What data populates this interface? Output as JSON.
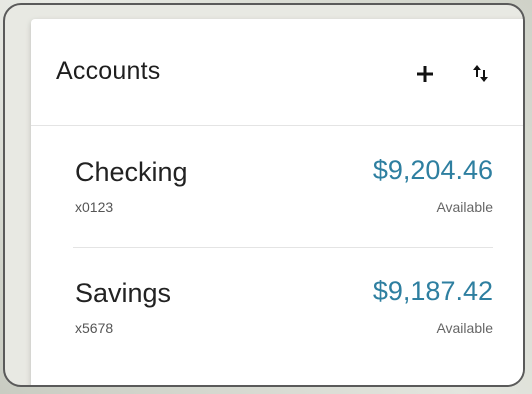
{
  "card": {
    "title": "Accounts",
    "actions": {
      "add_icon": "plus-icon",
      "sort_icon": "sort-arrows-icon"
    }
  },
  "accounts": [
    {
      "name": "Checking",
      "number": "x0123",
      "balance": "$9,204.46",
      "balance_label": "Available"
    },
    {
      "name": "Savings",
      "number": "x5678",
      "balance": "$9,187.42",
      "balance_label": "Available"
    }
  ],
  "colors": {
    "balance": "#2e7fa0",
    "card_background": "#ffffff",
    "divider": "#e4e4e4"
  }
}
